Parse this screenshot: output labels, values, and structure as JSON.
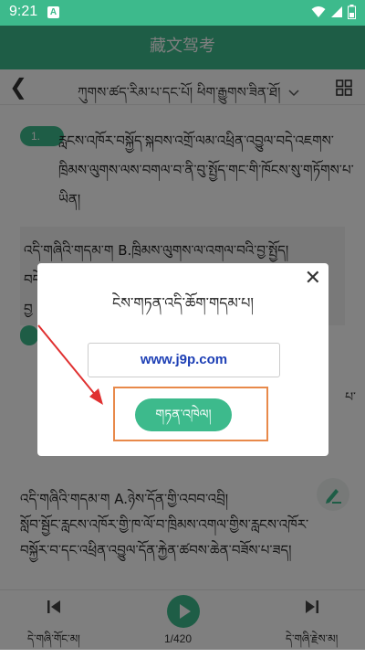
{
  "status_bar": {
    "time": "9:21",
    "badge": "A",
    "icons": [
      "wifi-icon",
      "signal-icon",
      "battery-icon"
    ]
  },
  "app_bar": {
    "title": "藏文驾考"
  },
  "nav": {
    "back_icon": "chevron-left-icon",
    "title": "ཀུགས་ཚད་རིམ་པ་དང་པོ། ཕིག་རྒྱུགས་ཟིན་ཐོ།",
    "grid_icon": "grid-icon"
  },
  "question": {
    "number": "1.",
    "text": "རླངས་འཁོར་བསྐྱོད་སྐབས་འགྲོ་ལམ་འཕྲིན་འབྱུལ་བདེ་འཇགས་ཁྲིམས་ལུགས་ལས་བགལ་བ་ནི་བུ་སྤྱོད་གང་གི་ཁོངས་སུ་གཏོགས་པ་ཡིན།"
  },
  "answer": {
    "line1": "འདི་གཞིའི་གདམ་ག  B.ཁྲིམས་ལུགས་ལ་འགལ་བའི་བྱ་སྤྱོད།",
    "line2": "བདེ",
    "line3": "བྱ"
  },
  "question2": {
    "right_text": "པ་"
  },
  "explanation": {
    "line1": "འདི་གཞིའི་གདམ་ག  A.ཉེས་དོན་གྱི་འབབ་འབྲི།",
    "line2": "སློབ་སྦྱོང་རླངས་འཁོར་གྱི་ཁ་ལོ་བ་ཁྲིམས་འགལ་གྱིས་རླངས་འཁོར་",
    "line3": "བསྐྱོར་བ་དང་འཕྲིན་འབྱུལ་དོན་རྐྱེན་ཚབས་ཆེན་བཟོས་པ་ཟད།"
  },
  "bottom_bar": {
    "prev_label": "དེ་གཞི་གོང་མ།",
    "counter": "1/420",
    "next_label": "དེ་གཞི་རྗེས་མ།"
  },
  "dialog": {
    "title": "ངེས་གཏན་འདི་ཆོག་གདམ་པ།",
    "field_value": "www.j9p.com",
    "confirm_label": "གཏན་འཁེལ།",
    "close_icon": "close-icon"
  },
  "colors": {
    "accent": "#3dba8c",
    "highlight": "#e8894a",
    "arrow": "#e03030",
    "link": "#1d3fb5"
  }
}
